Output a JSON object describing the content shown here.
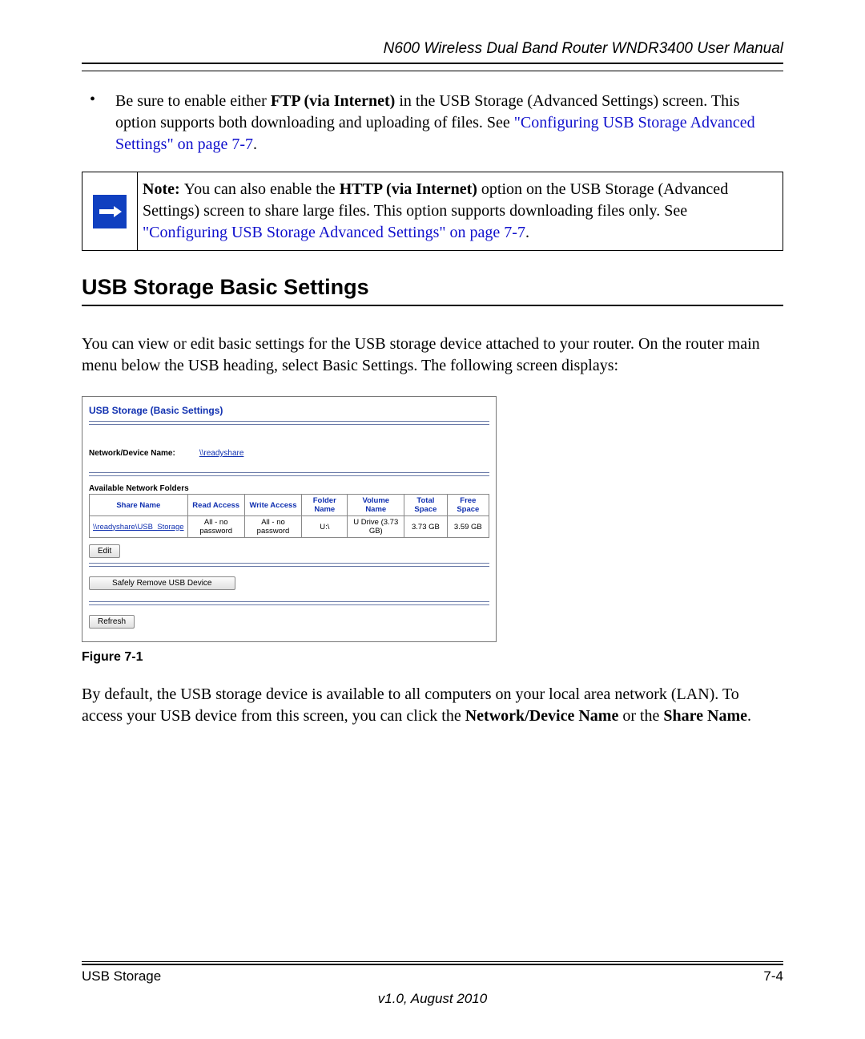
{
  "header": {
    "title": "N600 Wireless Dual Band Router WNDR3400 User Manual"
  },
  "bullet": {
    "pre": "Be sure to enable either ",
    "bold1": "FTP (via Internet)",
    "mid1": " in the USB Storage (Advanced Settings) screen. This option supports both downloading and uploading of files. See ",
    "link": "\"Configuring USB Storage Advanced Settings\" on page 7-7",
    "end": "."
  },
  "note": {
    "lead": "Note: ",
    "t1": "You can also enable the ",
    "b1": "HTTP (via Internet)",
    "t2": " option on the USB Storage (Advanced Settings) screen to share large files. This option supports downloading files only. See ",
    "link": "\"Configuring USB Storage Advanced Settings\" on page 7-7",
    "t3": "."
  },
  "section": {
    "heading": "USB Storage Basic Settings"
  },
  "intro": "You can view or edit basic settings for the USB storage device attached to your router. On the router main menu below the USB heading, select Basic Settings. The following screen displays:",
  "screenshot": {
    "title": "USB Storage (Basic Settings)",
    "field_label": "Network/Device Name:",
    "field_value": "\\\\readyshare",
    "subhead": "Available Network Folders",
    "cols": [
      "Share Name",
      "Read Access",
      "Write Access",
      "Folder Name",
      "Volume Name",
      "Total Space",
      "Free Space"
    ],
    "row": {
      "share": "\\\\readyshare\\USB_Storage",
      "read": "All - no password",
      "write": "All - no password",
      "folder": "U:\\",
      "volume": "U Drive (3.73 GB)",
      "total": "3.73 GB",
      "free": "3.59 GB"
    },
    "btn_edit": "Edit",
    "btn_remove": "Safely Remove USB Device",
    "btn_refresh": "Refresh"
  },
  "figure": "Figure 7-1",
  "para2": {
    "t1": "By default, the USB storage device is available to all computers on your local area network (LAN). To access your USB device from this screen, you can click the ",
    "b1": "Network/Device Name",
    "t2": " or the ",
    "b2": "Share Name",
    "t3": "."
  },
  "footer": {
    "left": "USB Storage",
    "right": "7-4",
    "version": "v1.0, August 2010"
  }
}
